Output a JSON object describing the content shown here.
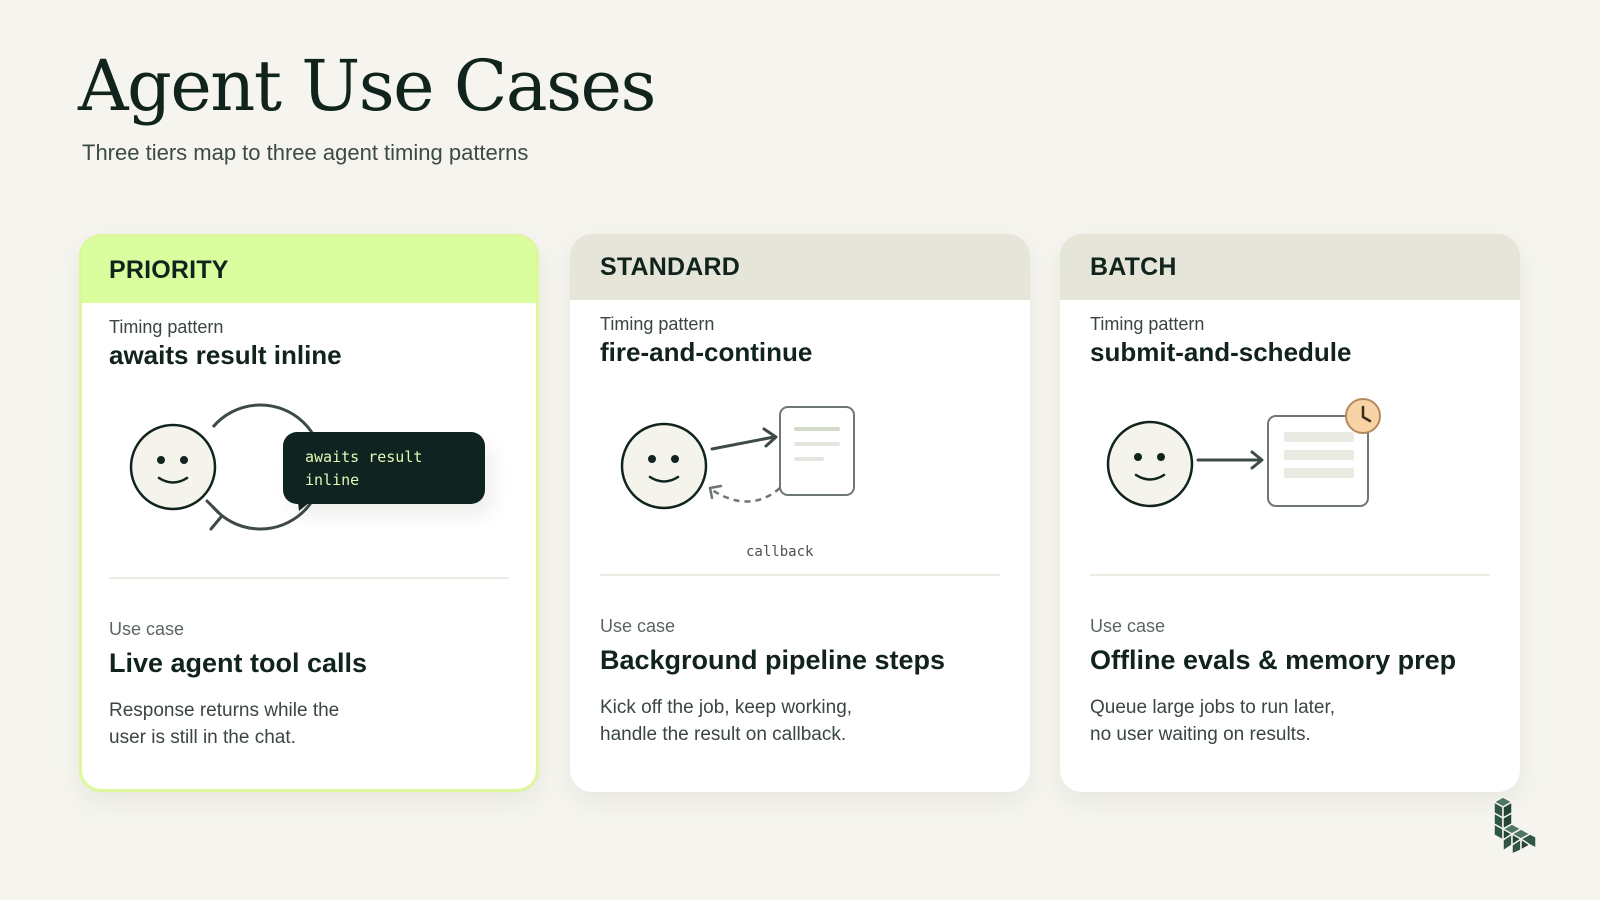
{
  "header": {
    "title": "Agent Use Cases",
    "subtitle": "Three tiers map to three agent timing patterns"
  },
  "colors": {
    "background": "#f5f4ee",
    "priority_accent": "#dafd9d",
    "header_neutral": "#e6e5d9",
    "dark": "#10231c",
    "clock_badge": "#f7d3a6"
  },
  "cards": [
    {
      "tier": "PRIORITY",
      "timing_label": "Timing pattern",
      "timing_value": "awaits result inline",
      "illustration_text": [
        "awaits result",
        "inline"
      ],
      "usecase_label": "Use case",
      "usecase_value": "Live agent tool calls",
      "description": [
        "Response returns while the",
        "user is still in the chat."
      ]
    },
    {
      "tier": "STANDARD",
      "timing_label": "Timing pattern",
      "timing_value": "fire-and-continue",
      "illustration_text": [
        "callback"
      ],
      "usecase_label": "Use case",
      "usecase_value": "Background pipeline steps",
      "description": [
        "Kick off the job, keep working,",
        "handle the result on callback."
      ]
    },
    {
      "tier": "BATCH",
      "timing_label": "Timing pattern",
      "timing_value": "submit-and-schedule",
      "usecase_label": "Use case",
      "usecase_value": "Offline evals & memory prep",
      "description": [
        "Queue large jobs to run later,",
        "no user waiting on results."
      ]
    }
  ]
}
